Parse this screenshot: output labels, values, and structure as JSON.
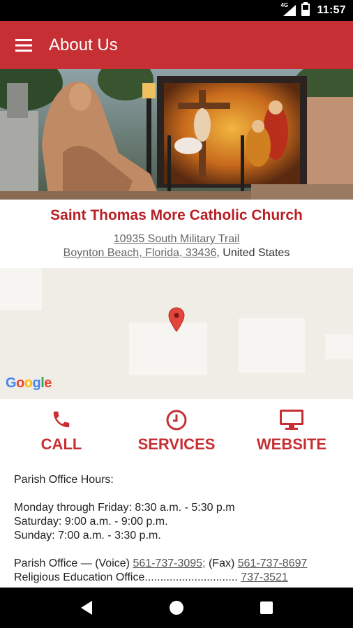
{
  "status_bar": {
    "network": "4G",
    "time": "11:57",
    "icons": [
      "signal-icon",
      "battery-icon"
    ]
  },
  "app_bar": {
    "title": "About Us",
    "menu_icon": "hamburger-menu-icon"
  },
  "hero": {
    "image": "church-statue-and-mosaic-photo"
  },
  "church": {
    "name": "Saint Thomas More Catholic Church",
    "address_line1": "10935 South Military Trail",
    "address_line2_link": "Boynton Beach, Florida, 33436",
    "address_line2_suffix": ", United States"
  },
  "map": {
    "provider_logo": "Google",
    "marker_icon": "map-pin-icon"
  },
  "actions": [
    {
      "label": "CALL",
      "icon": "phone-icon"
    },
    {
      "label": "SERVICES",
      "icon": "clock-icon"
    },
    {
      "label": "WEBSITE",
      "icon": "monitor-icon"
    }
  ],
  "content": {
    "office_hours_heading": "Parish Office Hours:",
    "weekday_hours": "Monday through Friday: 8:30 a.m. - 5:30 p.m",
    "saturday_hours": "Saturday: 9:00 a.m. - 9:00 p.m.",
    "sunday_hours": "Sunday: 7:00 a.m. - 3:30 p.m.",
    "parish_office_prefix": "Parish Office — (Voice) ",
    "voice_phone": "561-737-3095;",
    "fax_prefix": " (Fax) ",
    "fax_phone": "561-737-8697",
    "religious_ed_prefix": "Religious Education Office.............................. ",
    "religious_ed_phone": "737-3521"
  },
  "nav_bar": {
    "buttons": [
      "back-icon",
      "home-icon",
      "recents-icon"
    ]
  },
  "colors": {
    "primary": "#c62f33",
    "title_red": "#b81f24"
  }
}
